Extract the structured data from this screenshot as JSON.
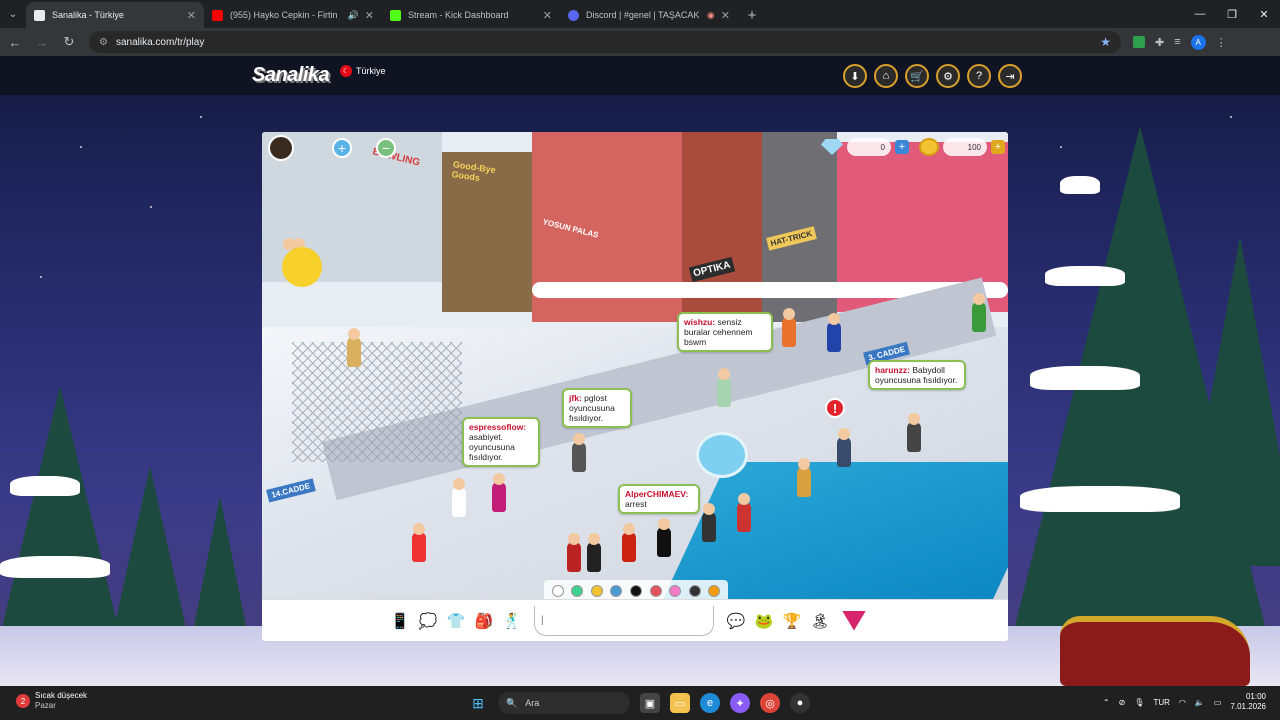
{
  "browser": {
    "tabs": [
      {
        "title": "Sanalika - Türkiye",
        "active": true,
        "favicon_color": "#ffffff"
      },
      {
        "title": "(955) Hayko Cepkin - Firtin",
        "active": false,
        "favicon_color": "#ff0000",
        "sound": true
      },
      {
        "title": "Stream - Kick Dashboard",
        "active": false,
        "favicon_color": "#53fc18"
      },
      {
        "title": "Discord | #genel | TAŞACAK",
        "active": false,
        "favicon_color": "#5865f2"
      }
    ],
    "new_tab": "+",
    "window_controls": {
      "minimize": "—",
      "maximize": "❐",
      "close": "✕"
    },
    "url": "sanalika.com/tr/play"
  },
  "site": {
    "logo": "Sanalika",
    "language": "Türkiye",
    "header_icons": [
      "download-icon",
      "home-icon",
      "cart-icon",
      "settings-icon",
      "help-icon",
      "logout-icon"
    ]
  },
  "game": {
    "currency": {
      "gems": "0",
      "coins": "100"
    },
    "signs": {
      "goodbye": "Good-Bye Goods",
      "bowling": "BOWLING",
      "yosun": "YOSUN PALAS",
      "optika": "OPTIKA",
      "hattrick": "HAT-TRICK",
      "cadde14": "14.CADDE",
      "cadde3": "3. CADDE"
    },
    "bubbles": [
      {
        "nick": "wishzu:",
        "text": "sensiz buralar cehennem bswm"
      },
      {
        "nick": "harunzz:",
        "text": "Babydoll oyuncusuna fısıldıyor."
      },
      {
        "nick": "jfk:",
        "text": "pglost oyuncusuna fısıldıyor."
      },
      {
        "nick": "espressoflow:",
        "text": "asabiyet. oyuncusuna fısıldıyor."
      },
      {
        "nick": "AlperCHIMAEV:",
        "text": "arrest"
      }
    ],
    "color_swatches": [
      "#ffffff",
      "#3fcf8e",
      "#f2c230",
      "#4a9bd6",
      "#111111",
      "#e2525b",
      "#f27ac8",
      "#333333",
      "#f39c12"
    ],
    "chat_placeholder": "|",
    "chat_cursor": "I"
  },
  "taskbar": {
    "weather": {
      "line1": "Sıcak düşecek",
      "line2": "Pazar",
      "badge": "2"
    },
    "search_label": "Ara",
    "tray": {
      "lang": "TUR",
      "time": "01:00",
      "date": "7.01.2026"
    }
  }
}
